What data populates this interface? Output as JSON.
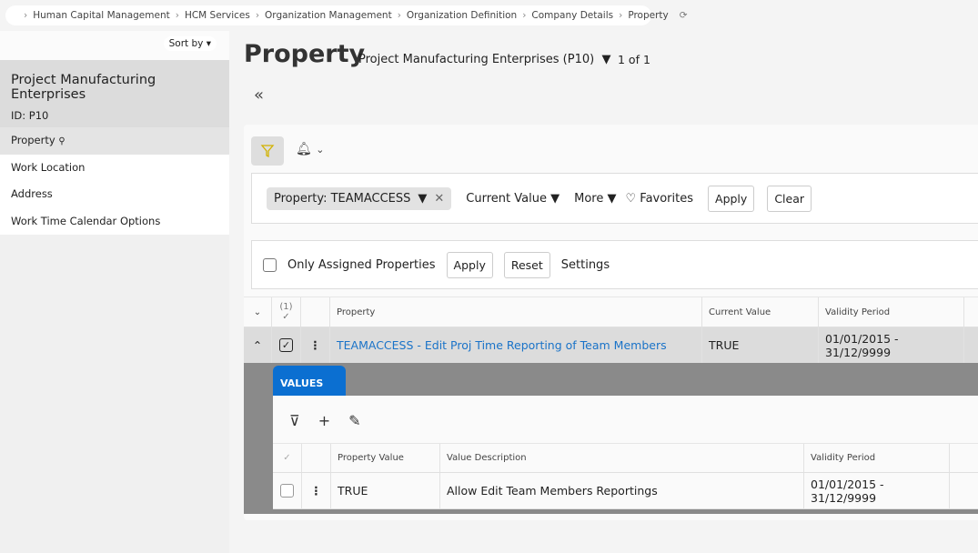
{
  "breadcrumb": [
    "Human Capital Management",
    "HCM Services",
    "Organization Management",
    "Organization Definition",
    "Company Details",
    "Property"
  ],
  "sidebar": {
    "sort_label": "Sort by",
    "record_title": "Project Manufacturing Enterprises",
    "record_id": "ID:  P10",
    "items": [
      {
        "label": "Property"
      },
      {
        "label": "Work Location"
      },
      {
        "label": "Address"
      },
      {
        "label": "Work Time Calendar Options"
      }
    ]
  },
  "header": {
    "title": "Property",
    "context": "Project Manufacturing Enterprises (P10)",
    "count": "1 of 1"
  },
  "filters": {
    "chip": "Property: TEAMACCESS",
    "current_value": "Current Value",
    "more": "More",
    "favorites": "Favorites",
    "apply": "Apply",
    "clear": "Clear"
  },
  "assigned": {
    "label": "Only Assigned Properties",
    "apply": "Apply",
    "reset": "Reset",
    "settings": "Settings"
  },
  "table": {
    "selected_count": "(1)",
    "columns": [
      "Property",
      "Current Value",
      "Validity Period"
    ],
    "row": {
      "property": "TEAMACCESS - Edit Proj Time Reporting of Team Members",
      "current_value": "TRUE",
      "validity": "01/01/2015 - 31/12/9999"
    }
  },
  "values": {
    "tab": "VALUES",
    "columns": [
      "Property Value",
      "Value Description",
      "Validity Period"
    ],
    "row": {
      "value": "TRUE",
      "description": "Allow Edit Team Members Reportings",
      "validity": "01/01/2015 - 31/12/9999"
    }
  },
  "colors": {
    "accent": "#0b6fd1",
    "link": "#1a73c8"
  }
}
